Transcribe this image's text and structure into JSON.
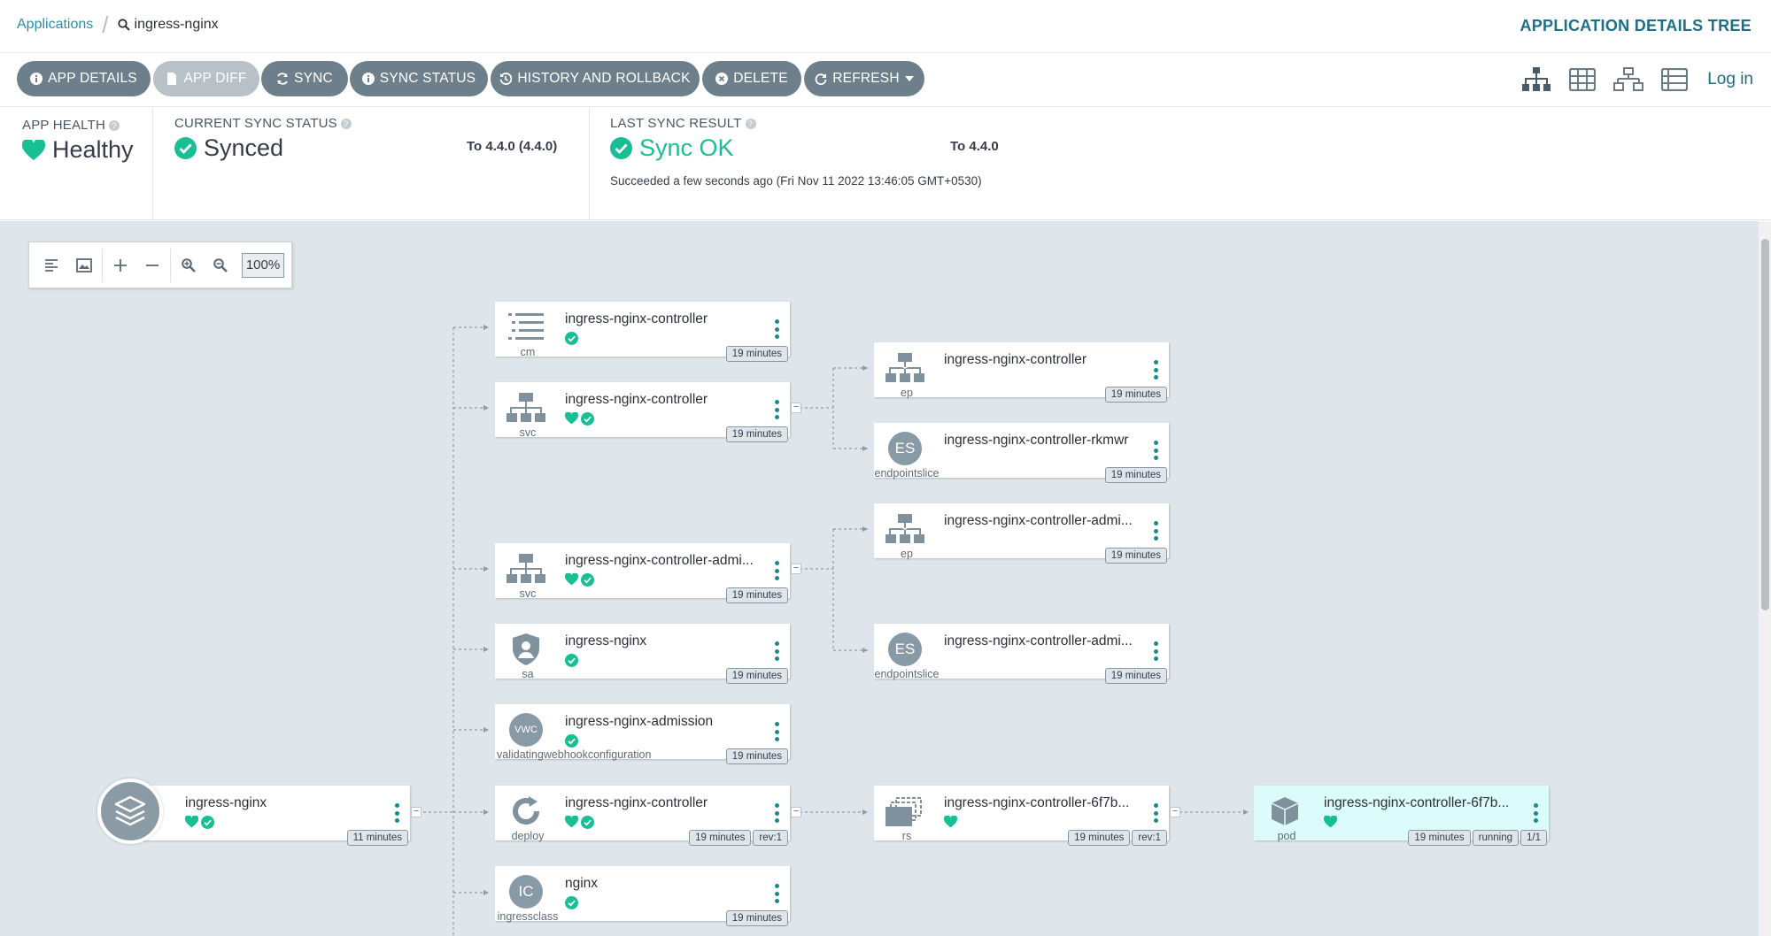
{
  "breadcrumb": {
    "root": "Applications",
    "current": "ingress-nginx"
  },
  "header": {
    "title": "APPLICATION DETAILS TREE"
  },
  "toolbar": {
    "app_details": "APP DETAILS",
    "app_diff": "APP DIFF",
    "sync": "SYNC",
    "sync_status": "SYNC STATUS",
    "history": "HISTORY AND ROLLBACK",
    "delete": "DELETE",
    "refresh": "REFRESH",
    "login": "Log in"
  },
  "status": {
    "health_label": "APP HEALTH",
    "health_value": "Healthy",
    "sync_label": "CURRENT SYNC STATUS",
    "sync_value": "Synced",
    "sync_target": "To 4.4.0 (4.4.0)",
    "last_label": "LAST SYNC RESULT",
    "last_value": "Sync OK",
    "last_target": "To 4.4.0",
    "last_detail": "Succeeded a few seconds ago (Fri Nov 11 2022 13:46:05 GMT+0530)"
  },
  "zoom": {
    "value": "100%"
  },
  "colors": {
    "healthy": "#18be94",
    "accent": "#1b6f86",
    "button": "#6d7f8b",
    "pod_bg": "#dcfbfb"
  },
  "nodes": {
    "cm": {
      "name": "ingress-nginx-controller",
      "kind": "cm",
      "age": "19 minutes"
    },
    "svc1": {
      "name": "ingress-nginx-controller",
      "kind": "svc",
      "age": "19 minutes"
    },
    "ep1": {
      "name": "ingress-nginx-controller",
      "kind": "ep",
      "age": "19 minutes"
    },
    "es1": {
      "name": "ingress-nginx-controller-rkmwr",
      "kind": "endpointslice",
      "icon": "ES",
      "age": "19 minutes"
    },
    "svc2": {
      "name": "ingress-nginx-controller-admi...",
      "kind": "svc",
      "age": "19 minutes"
    },
    "ep2": {
      "name": "ingress-nginx-controller-admi...",
      "kind": "ep",
      "age": "19 minutes"
    },
    "sa": {
      "name": "ingress-nginx",
      "kind": "sa",
      "age": "19 minutes"
    },
    "es2": {
      "name": "ingress-nginx-controller-admi...",
      "kind": "endpointslice",
      "icon": "ES",
      "age": "19 minutes"
    },
    "vwc": {
      "name": "ingress-nginx-admission",
      "kind": "validatingwebhookconfiguration",
      "icon": "VWC",
      "age": "19 minutes"
    },
    "root": {
      "name": "ingress-nginx",
      "age": "11 minutes"
    },
    "deploy": {
      "name": "ingress-nginx-controller",
      "kind": "deploy",
      "age": "19 minutes",
      "rev": "rev:1"
    },
    "rs": {
      "name": "ingress-nginx-controller-6f7b...",
      "kind": "rs",
      "age": "19 minutes",
      "rev": "rev:1"
    },
    "pod": {
      "name": "ingress-nginx-controller-6f7b...",
      "kind": "pod",
      "age": "19 minutes",
      "state": "running",
      "ready": "1/1"
    },
    "ic": {
      "name": "nginx",
      "kind": "ingressclass",
      "icon": "IC",
      "age": "19 minutes"
    }
  }
}
